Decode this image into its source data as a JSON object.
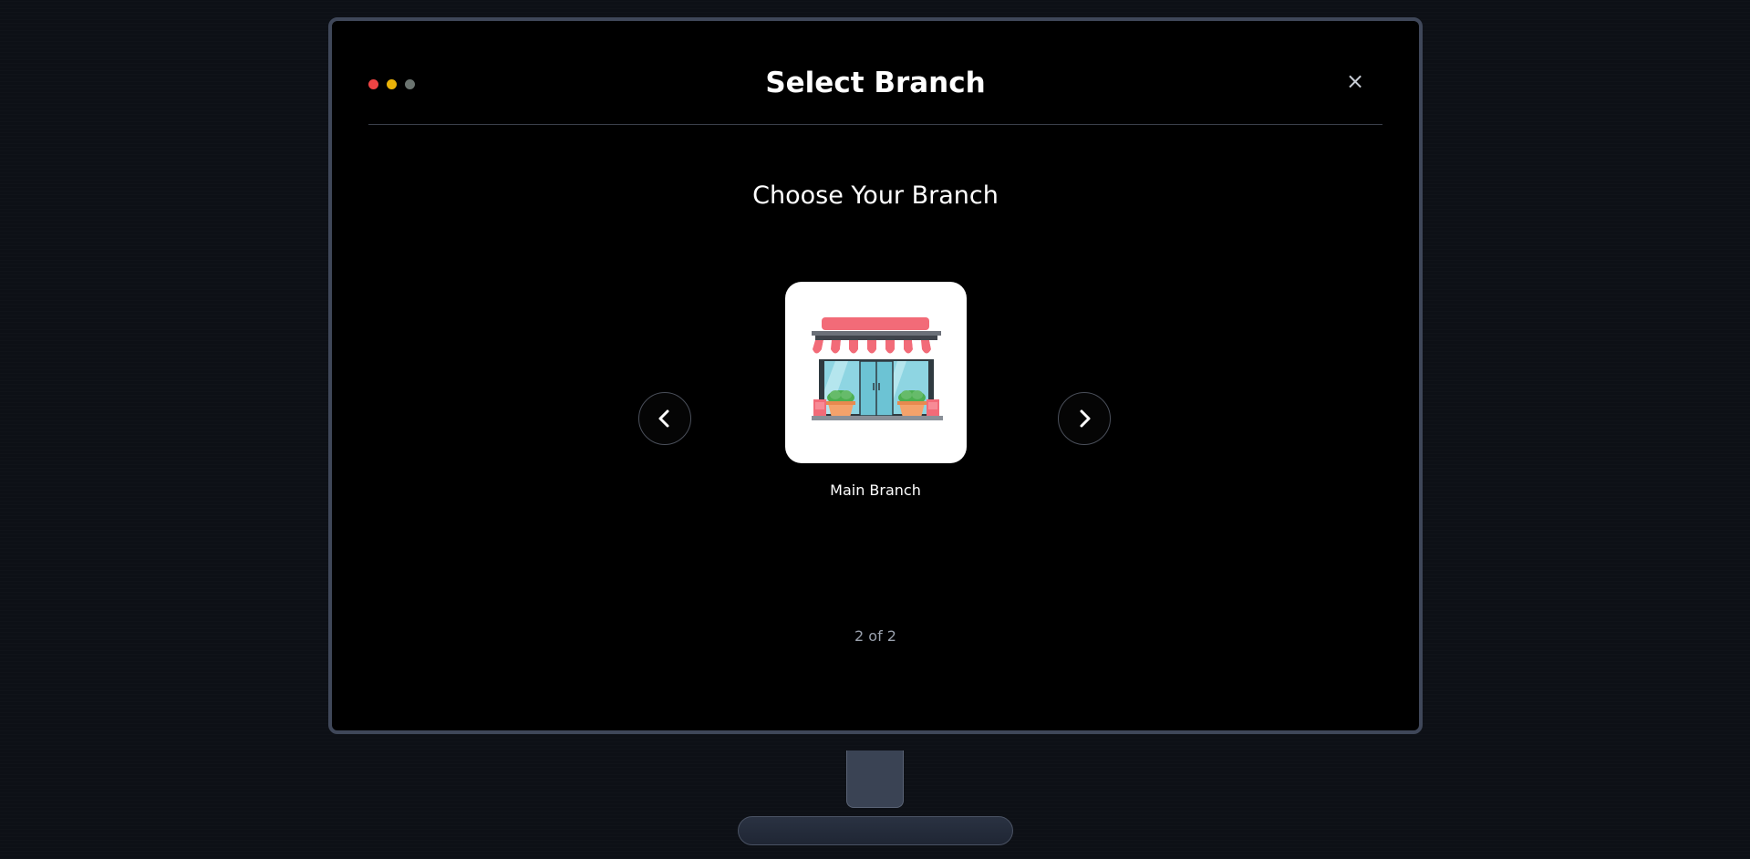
{
  "modal": {
    "title": "Select Branch",
    "close_label": "×",
    "window_dots": [
      "red",
      "yellow",
      "gray"
    ]
  },
  "content": {
    "heading": "Choose Your Branch",
    "branch": {
      "name": "Main Branch",
      "icon": "storefront-icon"
    },
    "pager": "2 of 2",
    "prev_icon": "chevron-left-icon",
    "next_icon": "chevron-right-icon"
  },
  "colors": {
    "background": "#0d1016",
    "monitor_border": "#3f4759",
    "card": "#ffffff",
    "awning": "#f26b78",
    "glass": "#7fd1e0"
  }
}
